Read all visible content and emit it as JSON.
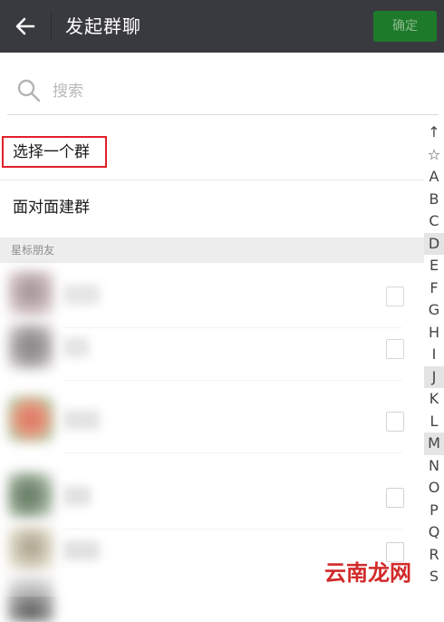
{
  "header": {
    "title": "发起群聊",
    "confirm_label": "确定",
    "back_icon": "arrow-left-icon",
    "bg_color": "#393a3f",
    "confirm_color": "#1c7a2a"
  },
  "search": {
    "placeholder": "搜索",
    "icon": "search-icon"
  },
  "options": {
    "select_group": "选择一个群",
    "face_to_face": "面对面建群"
  },
  "section": {
    "starred_friends": "星标朋友"
  },
  "index_bar": [
    "↑",
    "☆",
    "A",
    "B",
    "C",
    "D",
    "E",
    "F",
    "G",
    "H",
    "I",
    "J",
    "K",
    "L",
    "M",
    "N",
    "O",
    "P",
    "Q",
    "R",
    "S"
  ],
  "watermark": "云南龙网",
  "highlight_color": "#e0202a"
}
